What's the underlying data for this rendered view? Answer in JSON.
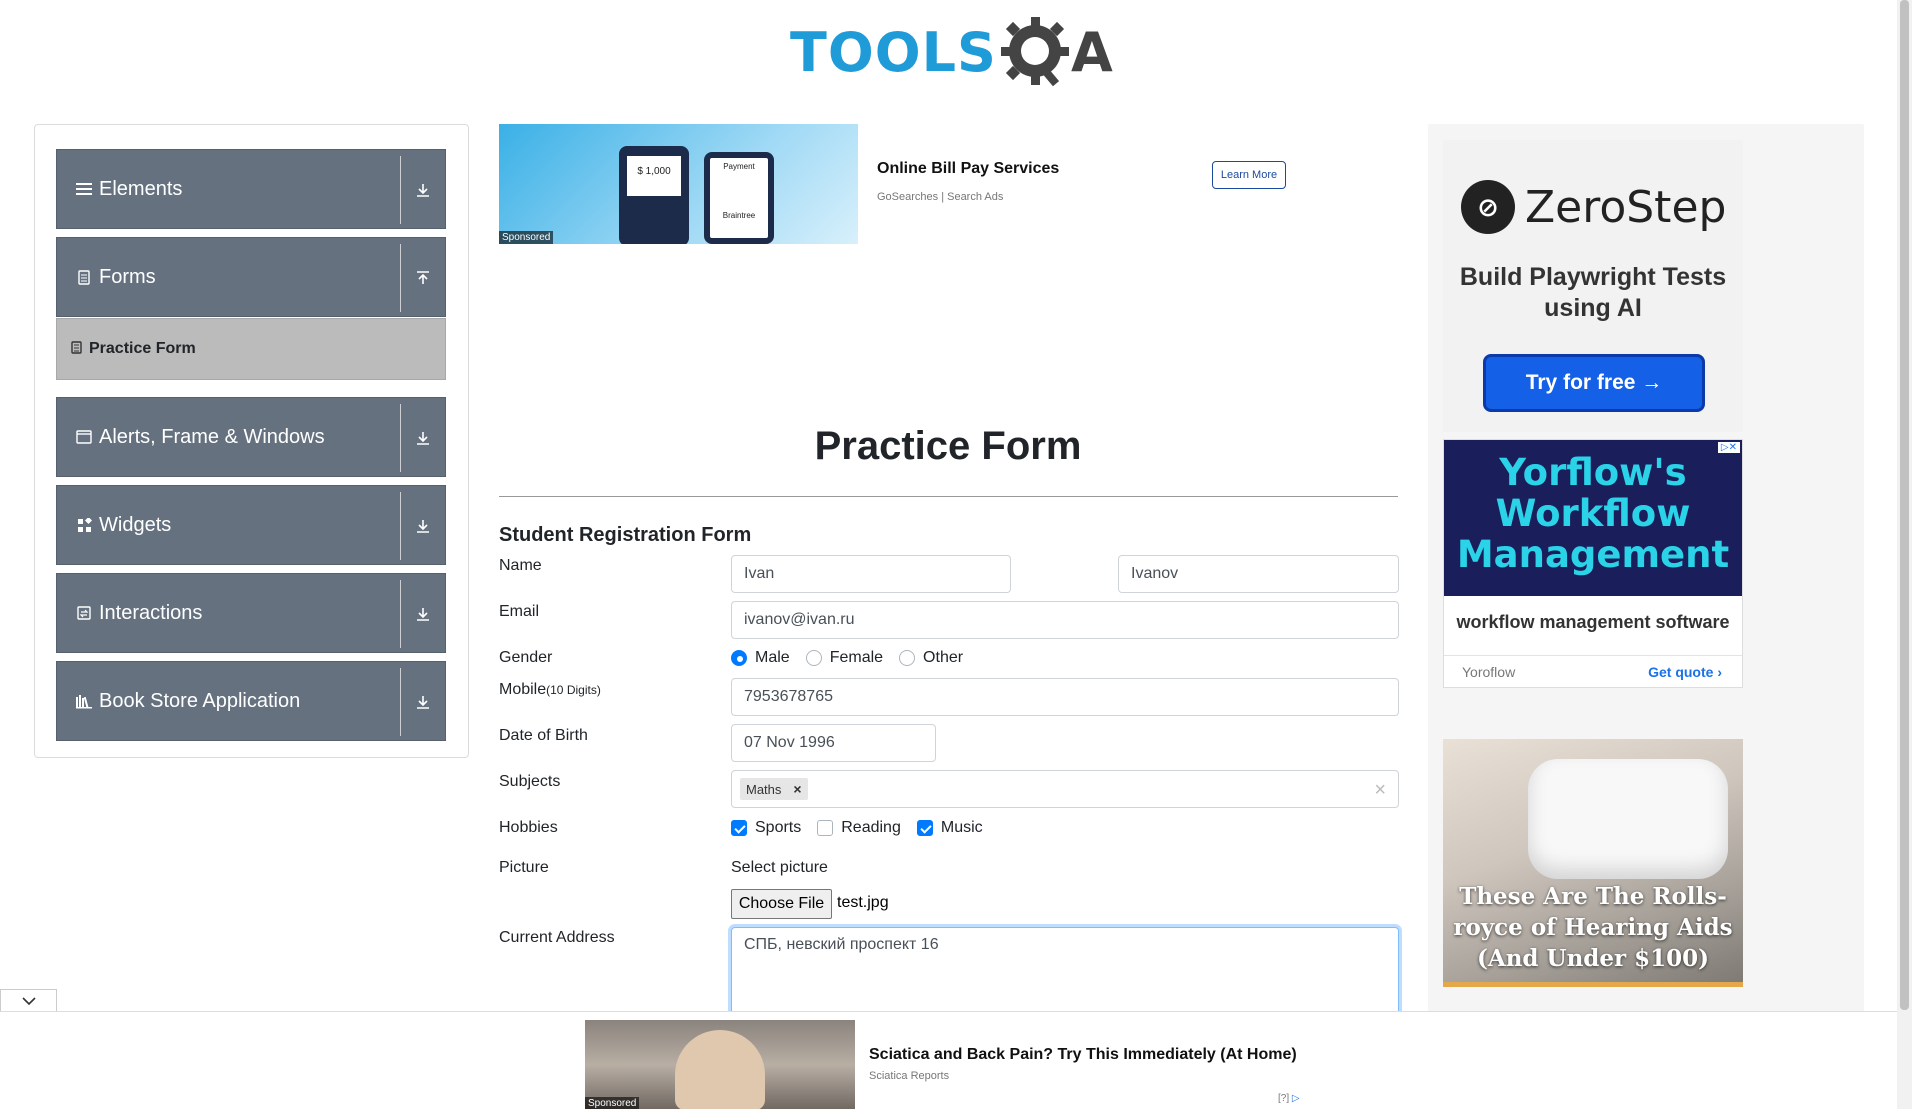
{
  "logo": {
    "text": "TOOLS",
    "accent": "A"
  },
  "sidebar": {
    "groups": [
      {
        "label": "Elements",
        "icon": "menu-icon"
      },
      {
        "label": "Forms",
        "icon": "document-icon"
      },
      {
        "label": "Alerts, Frame & Windows",
        "icon": "window-icon"
      },
      {
        "label": "Widgets",
        "icon": "widgets-icon"
      },
      {
        "label": "Interactions",
        "icon": "interactions-icon"
      },
      {
        "label": "Book Store Application",
        "icon": "bookstore-icon"
      }
    ],
    "active_item": {
      "label": "Practice Form",
      "icon": "form-icon"
    }
  },
  "top_ad": {
    "title": "Online Bill Pay Services",
    "source": "GoSearches | Search Ads",
    "cta": "Learn More",
    "sponsored": "Sponsored",
    "phone_amount": "$ 1,000",
    "phone_label": "Payment",
    "card_brand": "Braintree"
  },
  "form": {
    "page_title": "Practice Form",
    "section_title": "Student Registration Form",
    "labels": {
      "name": "Name",
      "email": "Email",
      "gender": "Gender",
      "mobile": "Mobile",
      "mobile_hint": "(10 Digits)",
      "dob": "Date of Birth",
      "subjects": "Subjects",
      "hobbies": "Hobbies",
      "picture": "Picture",
      "address": "Current Address"
    },
    "first_name": "Ivan",
    "last_name": "Ivanov",
    "email": "ivanov@ivan.ru",
    "gender_options": [
      "Male",
      "Female",
      "Other"
    ],
    "gender_selected": "Male",
    "mobile": "7953678765",
    "dob": "07 Nov 1996",
    "subjects": [
      "Maths"
    ],
    "subject_remove": "×",
    "subjects_clear": "×",
    "hobbies": [
      {
        "label": "Sports",
        "checked": true
      },
      {
        "label": "Reading",
        "checked": false
      },
      {
        "label": "Music",
        "checked": true
      }
    ],
    "picture_prompt": "Select picture",
    "choose_file": "Choose File",
    "file_name": "test.jpg",
    "address": "СПБ, невский проспект 16"
  },
  "right_ads": {
    "zerostep": {
      "brand": "ZeroStep",
      "tagline": "Build Playwright Tests using AI",
      "cta": "Try for free →"
    },
    "yorflow": {
      "headline": "Yorflow's Workflow Management",
      "description": "workflow management software",
      "brand": "Yoroflow",
      "cta": "Get quote"
    },
    "hearing": {
      "headline": "These Are The Rolls-royce of Hearing Aids (And Under $100)"
    }
  },
  "bottom_ad": {
    "title": "Sciatica and Back Pain? Try This Immediately (At Home)",
    "source": "Sciatica Reports",
    "sponsored": "Sponsored",
    "adchoice": "[?]"
  },
  "colors": {
    "sidebar_group": "#65717f",
    "sidebar_active": "#bbbbbb",
    "accent": "#007bff",
    "logo_blue": "#1f9bd8"
  }
}
